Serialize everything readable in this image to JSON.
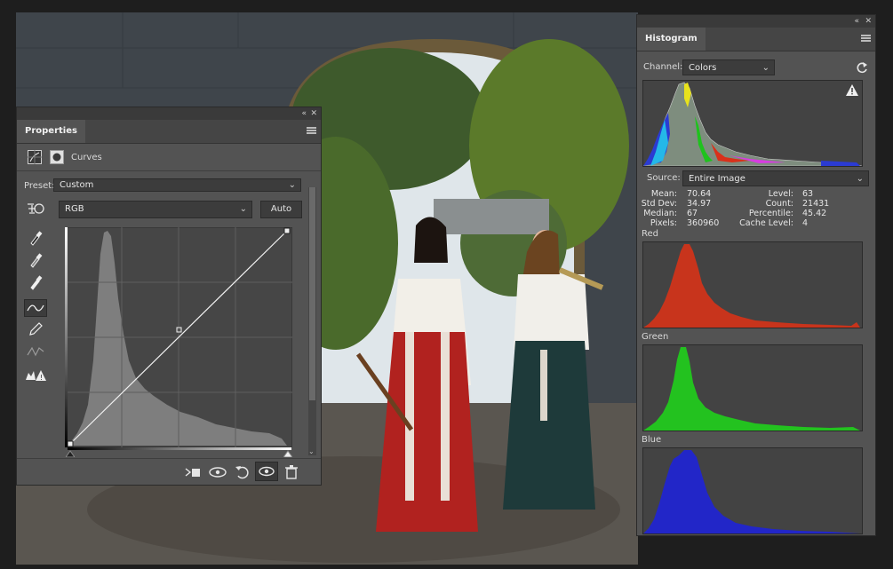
{
  "properties": {
    "tab": "Properties",
    "adjustment_label": "Curves",
    "preset_label": "Preset:",
    "preset_value": "Custom",
    "channel_value": "RGB",
    "auto_label": "Auto"
  },
  "histogram": {
    "tab": "Histogram",
    "channel_label": "Channel:",
    "channel_value": "Colors",
    "source_label": "Source:",
    "source_value": "Entire Image",
    "stats": {
      "mean_label": "Mean:",
      "mean": "70.64",
      "stddev_label": "Std Dev:",
      "stddev": "34.97",
      "median_label": "Median:",
      "median": "67",
      "pixels_label": "Pixels:",
      "pixels": "360960",
      "level_label": "Level:",
      "level": "63",
      "count_label": "Count:",
      "count": "21431",
      "percentile_label": "Percentile:",
      "percentile": "45.42",
      "cache_label": "Cache Level:",
      "cache": "4"
    },
    "red_label": "Red",
    "green_label": "Green",
    "blue_label": "Blue"
  },
  "colors": {
    "panel": "#535353",
    "red_hist": "#c8341c",
    "green_hist": "#23c21f",
    "blue_hist": "#2226c8",
    "gray_hist": "#7e7e7e"
  },
  "icons": [
    "collapse-icon",
    "close-icon",
    "panel-menu-icon",
    "curves-adjustment-icon",
    "layer-mask-icon",
    "target-adjust-icon",
    "black-eyedropper-icon",
    "gray-eyedropper-icon",
    "white-eyedropper-icon",
    "curve-points-icon",
    "pencil-icon",
    "smooth-icon",
    "clipping-warning-icon",
    "clip-to-layer-icon",
    "view-previous-icon",
    "reset-icon",
    "visibility-icon",
    "delete-icon",
    "refresh-icon",
    "warning-icon"
  ]
}
